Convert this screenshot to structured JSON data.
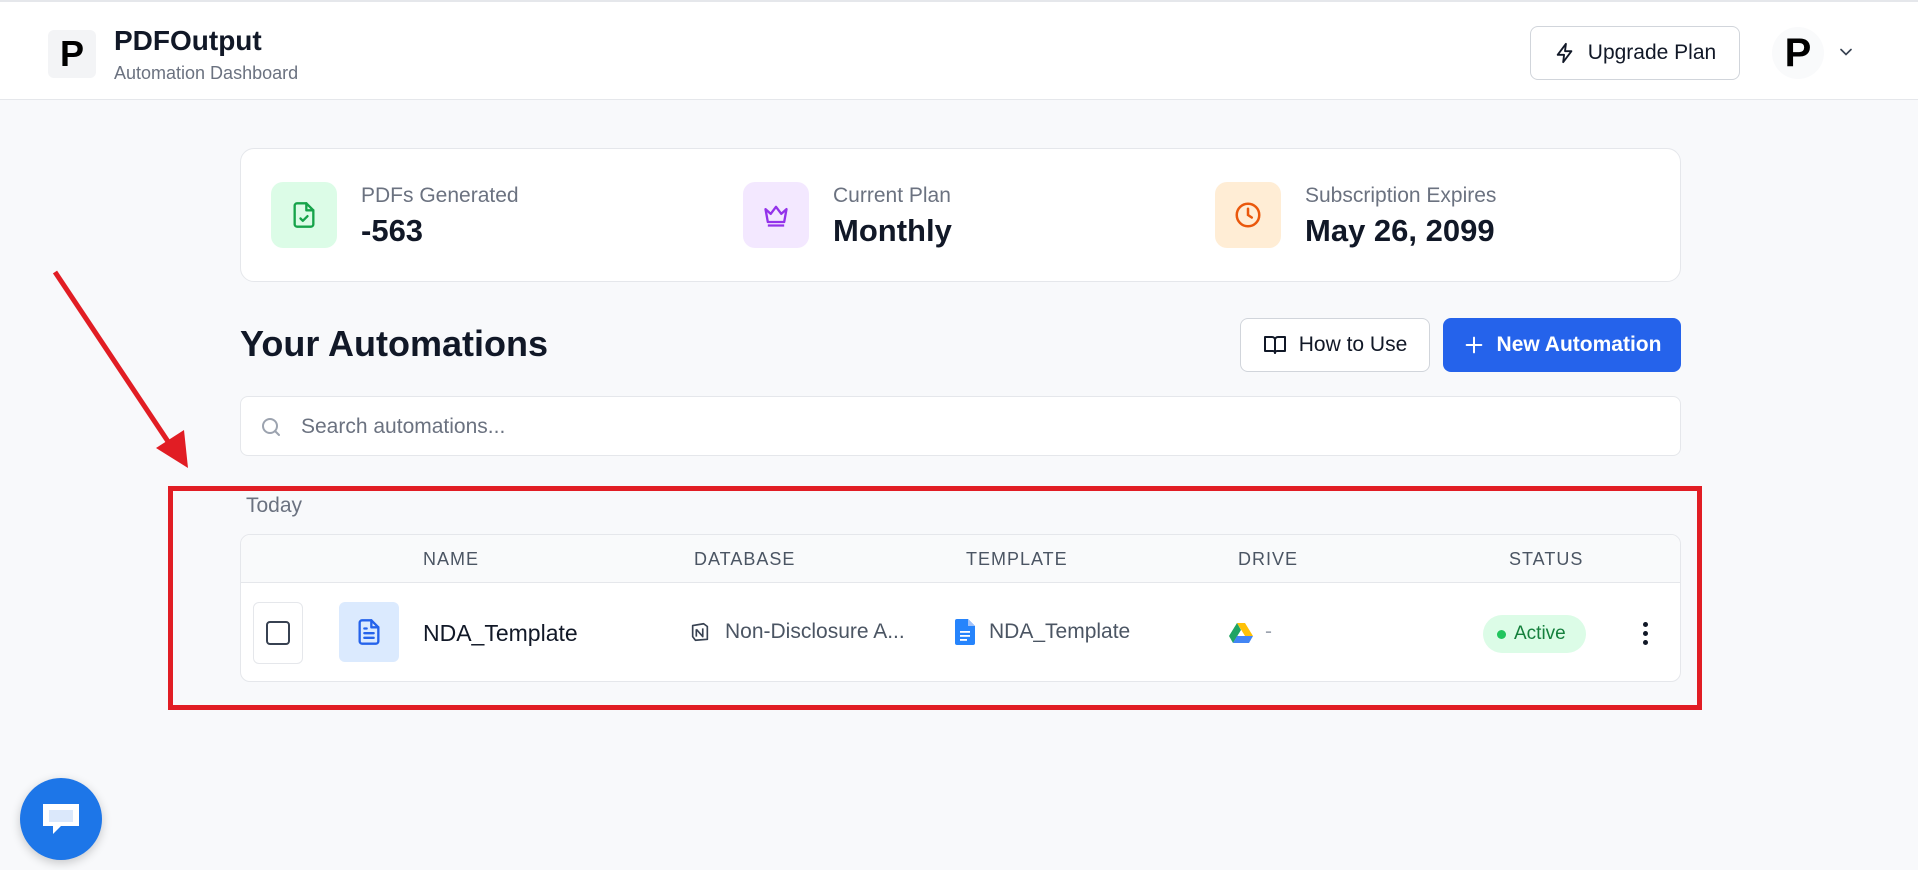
{
  "header": {
    "logo_letter": "P",
    "app_title": "PDFOutput",
    "app_subtitle": "Automation Dashboard",
    "upgrade_label": "Upgrade Plan",
    "avatar_letter": "P"
  },
  "stats": [
    {
      "label": "PDFs Generated",
      "value": "-563",
      "icon": "file-check-icon",
      "color": "#16a34a",
      "bg": "#dcfce7"
    },
    {
      "label": "Current Plan",
      "value": "Monthly",
      "icon": "crown-icon",
      "color": "#9333ea",
      "bg": "#f3e8ff"
    },
    {
      "label": "Subscription Expires",
      "value": "May 26, 2099",
      "icon": "clock-icon",
      "color": "#ea580c",
      "bg": "#ffedd5"
    }
  ],
  "automations": {
    "title": "Your Automations",
    "how_to_label": "How to Use",
    "new_label": "New Automation",
    "search_placeholder": "Search automations...",
    "group_label": "Today",
    "columns": {
      "name": "NAME",
      "database": "DATABASE",
      "template": "TEMPLATE",
      "drive": "DRIVE",
      "status": "STATUS"
    },
    "rows": [
      {
        "name": "NDA_Template",
        "database": "Non-Disclosure A...",
        "template": "NDA_Template",
        "drive": "-",
        "status": "Active"
      }
    ]
  },
  "colors": {
    "accent": "#2563eb",
    "annotation": "#e11d24",
    "status_active_bg": "#dcfce7",
    "status_active_text": "#15803d"
  }
}
